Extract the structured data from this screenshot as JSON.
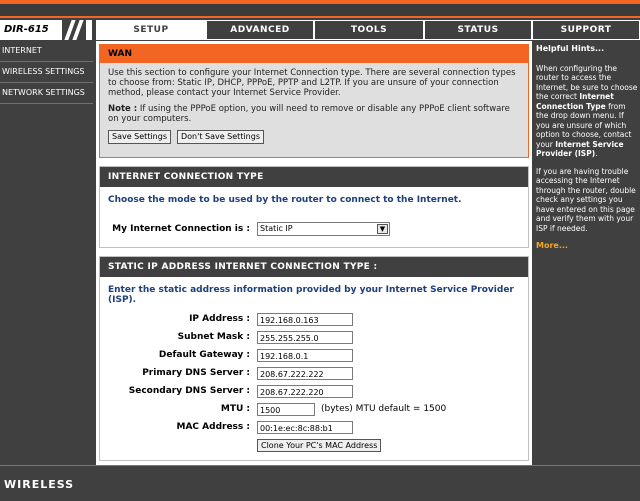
{
  "model": "DIR-615",
  "tabs": [
    {
      "label": "SETUP"
    },
    {
      "label": "ADVANCED"
    },
    {
      "label": "TOOLS"
    },
    {
      "label": "STATUS"
    },
    {
      "label": "SUPPORT"
    }
  ],
  "sidebar": {
    "items": [
      {
        "label": "INTERNET"
      },
      {
        "label": "WIRELESS SETTINGS"
      },
      {
        "label": "NETWORK SETTINGS"
      }
    ]
  },
  "wan": {
    "title": "WAN",
    "desc": "Use this section to configure your Internet Connection type. There are several connection types to choose from: Static IP, DHCP, PPPoE, PPTP and L2TP. If you are unsure of your connection method, please contact your Internet Service Provider.",
    "note_label": "Note :",
    "note_text": " If using the PPPoE option, you will need to remove or disable any PPPoE client software on your computers.",
    "save_label": "Save Settings",
    "dont_save_label": "Don't Save Settings"
  },
  "connection_type": {
    "title": "INTERNET CONNECTION TYPE",
    "subtitle": "Choose the mode to be used by the router to connect to the Internet.",
    "label": "My Internet Connection is :",
    "value": "Static IP"
  },
  "static": {
    "title": "STATIC IP ADDRESS INTERNET CONNECTION TYPE :",
    "subtitle": "Enter the static address information provided by your Internet Service Provider (ISP).",
    "fields": [
      {
        "label": "IP Address :",
        "value": "192.168.0.163"
      },
      {
        "label": "Subnet Mask :",
        "value": "255.255.255.0"
      },
      {
        "label": "Default Gateway :",
        "value": "192.168.0.1"
      },
      {
        "label": "Primary DNS Server :",
        "value": "208.67.222.222"
      },
      {
        "label": "Secondary DNS Server :",
        "value": "208.67.222.220"
      },
      {
        "label": "MTU :",
        "value": "1500"
      },
      {
        "label": "MAC Address :",
        "value": "00:1e:ec:8c:88:b1"
      }
    ],
    "mtu_note": "(bytes) MTU default = 1500",
    "clone_label": "Clone Your PC's MAC Address"
  },
  "hints": {
    "title": "Helpful Hints...",
    "p1_a": "When configuring the router to access the Internet, be sure to choose the correct ",
    "p1_b": "Internet Connection Type",
    "p1_c": " from the drop down menu. If you are unsure of which option to choose, contact your ",
    "p1_d": "Internet Service Provider (ISP)",
    "p1_e": ".",
    "p2": "If you are having trouble accessing the Internet through the router, double check any settings you have entered on this page and verify them with your ISP if needed.",
    "more": "More..."
  },
  "footer": {
    "brand": "WIRELESS"
  }
}
